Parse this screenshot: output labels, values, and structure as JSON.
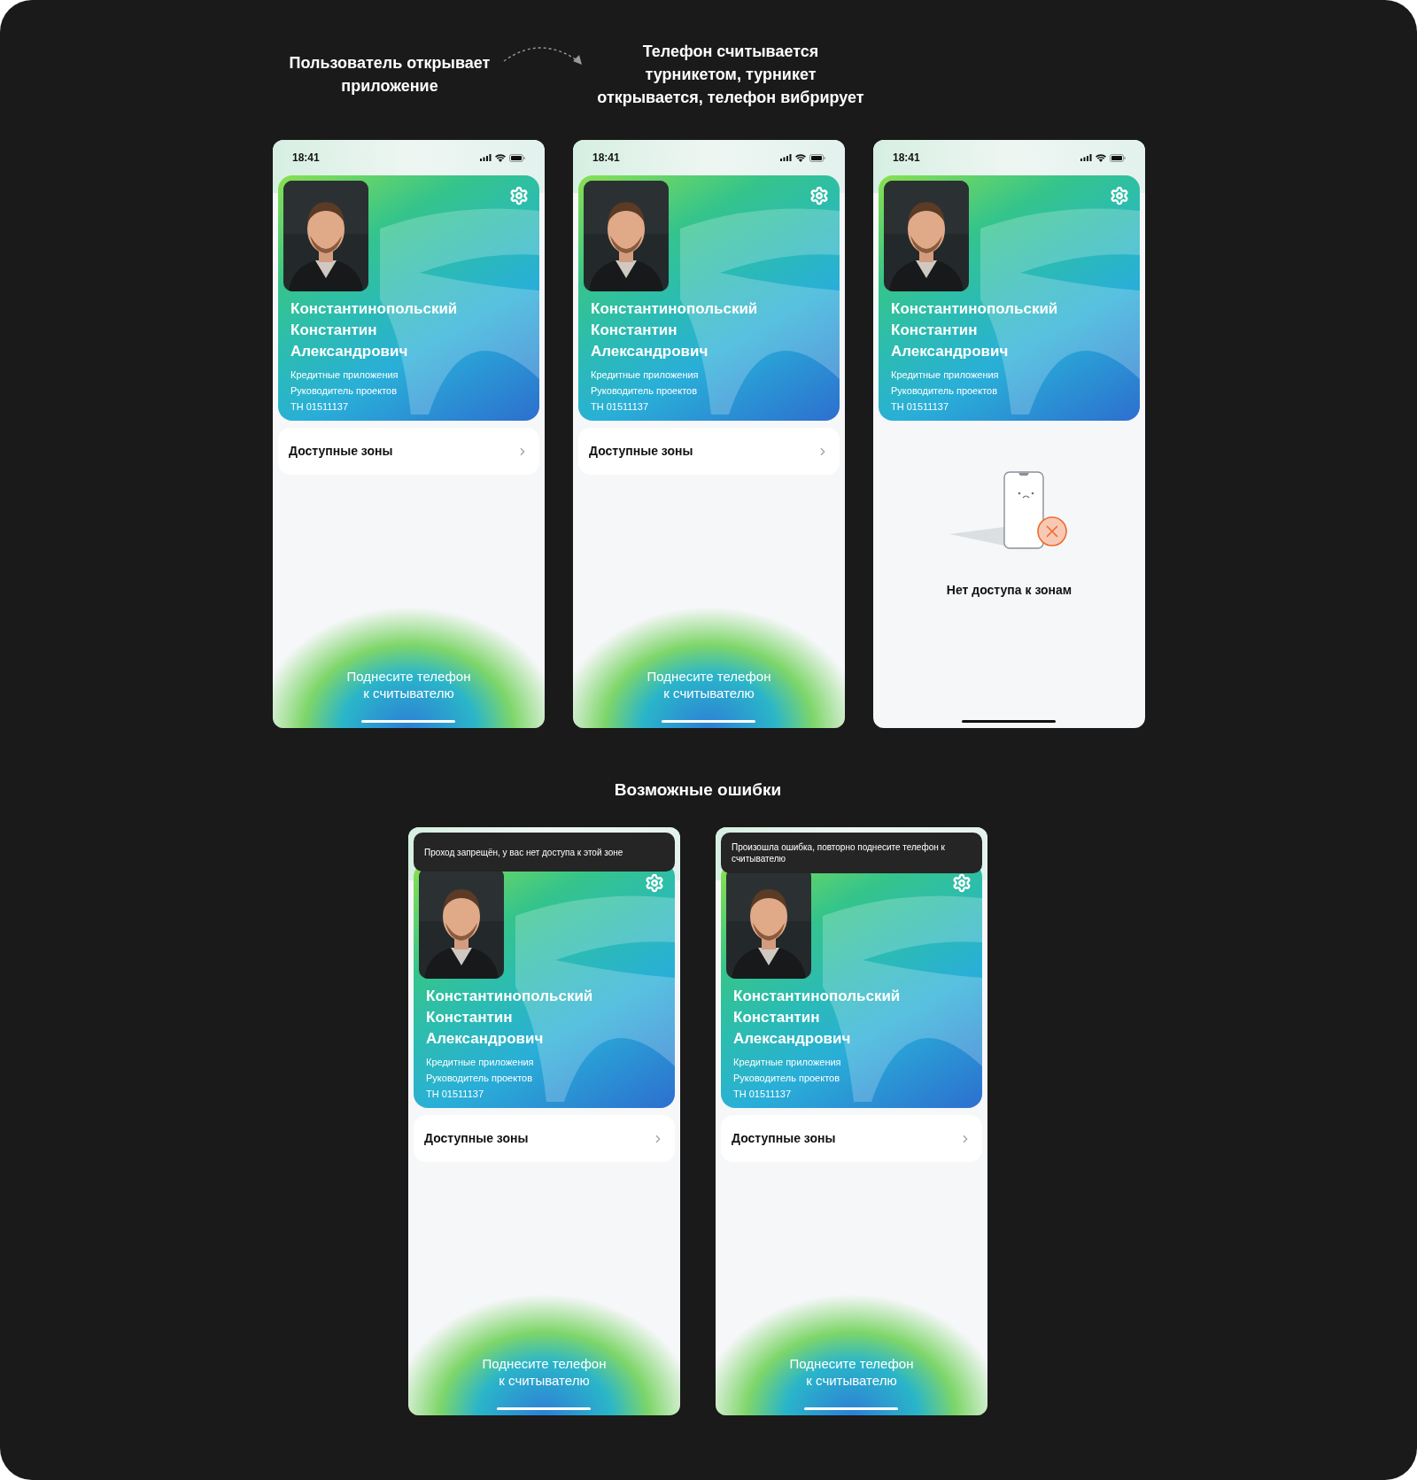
{
  "flow": {
    "steps": [
      {
        "lines": [
          "Пользователь открывает",
          "приложение"
        ]
      },
      {
        "lines": [
          "Телефон считывается",
          "турникетом, турникет",
          "открывается, телефон вибрирует"
        ]
      }
    ]
  },
  "screens": [
    {
      "kind": "reader",
      "time": "18:41",
      "card": {
        "name_lines": [
          "Константинопольский",
          "Константин",
          "Александрович"
        ],
        "department": "Кредитные приложения",
        "position": "Руководитель проектов",
        "number": "ТН 01511137"
      },
      "zones_label": "Доступные зоны",
      "hint_lines": [
        "Поднесите телефон",
        "к считывателю"
      ]
    },
    {
      "kind": "reader",
      "time": "18:41",
      "card": {
        "name_lines": [
          "Константинопольский",
          "Константин",
          "Александрович"
        ],
        "department": "Кредитные приложения",
        "position": "Руководитель проектов",
        "number": "ТН 01511137"
      },
      "zones_label": "Доступные зоны",
      "hint_lines": [
        "Поднесите телефон",
        "к считывателю"
      ]
    },
    {
      "kind": "no_access",
      "time": "18:41",
      "card": {
        "name_lines": [
          "Константинопольский",
          "Константин",
          "Александрович"
        ],
        "department": "Кредитные приложения",
        "position": "Руководитель проектов",
        "number": "ТН 01511137"
      },
      "message": "Нет доступа к зонам"
    }
  ],
  "errors": {
    "title": "Возможные ошибки",
    "screens": [
      {
        "kind": "reader",
        "toast": "Проход запрещён, у вас нет доступа к этой зоне",
        "card": {
          "name_lines": [
            "Константинопольский",
            "Константин",
            "Александрович"
          ],
          "department": "Кредитные приложения",
          "position": "Руководитель проектов",
          "number": "ТН 01511137"
        },
        "zones_label": "Доступные зоны",
        "hint_lines": [
          "Поднесите телефон",
          "к считывателю"
        ]
      },
      {
        "kind": "reader",
        "toast": "Произошла ошибка, повторно поднесите телефон к считывателю",
        "card": {
          "name_lines": [
            "Константинопольский",
            "Константин",
            "Александрович"
          ],
          "department": "Кредитные приложения",
          "position": "Руководитель проектов",
          "number": "ТН 01511137"
        },
        "zones_label": "Доступные зоны",
        "hint_lines": [
          "Поднесите телефон",
          "к считывателю"
        ]
      }
    ]
  }
}
